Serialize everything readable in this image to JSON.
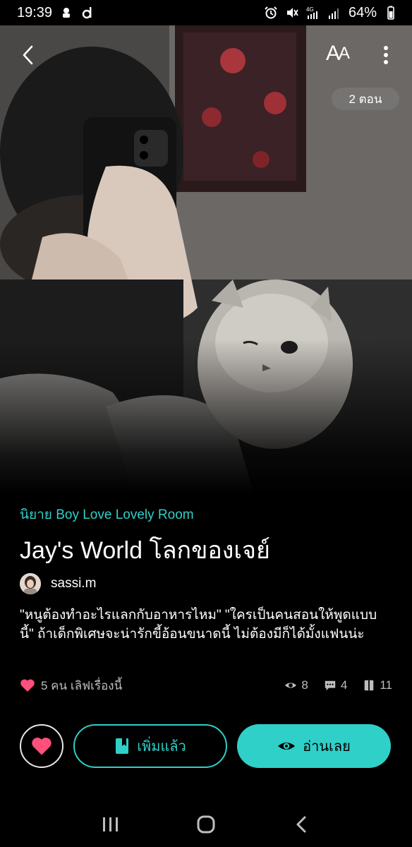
{
  "status_bar": {
    "time": "19:39",
    "battery": "64%",
    "network": "4G"
  },
  "cover": {
    "chapter_badge": "2 ตอน",
    "font_toggle": {
      "big": "A",
      "small": "A"
    }
  },
  "story": {
    "category": "นิยาย Boy Love Lovely Room",
    "title": "Jay's World โลกของเจย์",
    "author": "sassi.m",
    "synopsis": " \"หนูต้องทำอะไรแลกกับอาหารไหม\" \"ใครเป็นคนสอนให้พูดแบบนี้\" ถ้าเด็กพิเศษจะน่ารักขี้อ้อนขนาดนี้ ไม่ต้องมีก็ได้มั้งแฟนน่ะ",
    "likes_text": "5 คน เลิฟเรื่องนี้",
    "views": "8",
    "comments": "4",
    "chapters": "11"
  },
  "actions": {
    "added_label": "เพิ่มแล้ว",
    "read_label": "อ่านเลย"
  },
  "colors": {
    "accent": "#2fd0c8",
    "heart": "#ff4f7b",
    "background": "#000000"
  },
  "icons": [
    "back-icon",
    "font-size-icon",
    "more-icon",
    "heart-icon",
    "eye-icon",
    "comment-icon",
    "book-icon",
    "bookmark-icon"
  ]
}
